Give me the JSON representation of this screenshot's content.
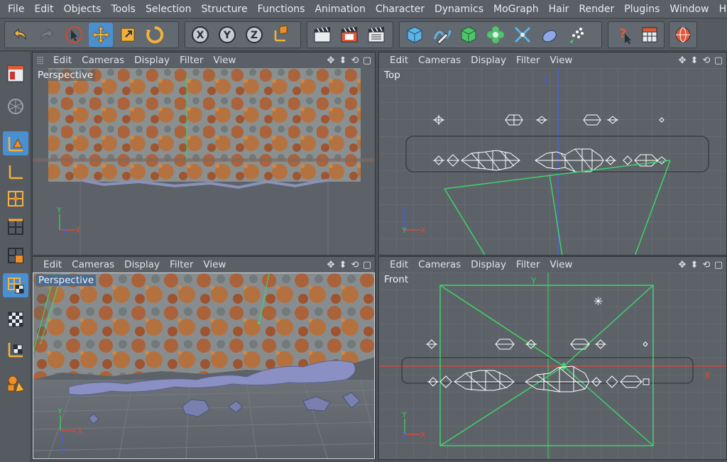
{
  "menubar": {
    "items": [
      "File",
      "Edit",
      "Objects",
      "Tools",
      "Selection",
      "Structure",
      "Functions",
      "Animation",
      "Character",
      "Dynamics",
      "MoGraph",
      "Hair",
      "Render",
      "Plugins",
      "Window",
      "Help"
    ]
  },
  "toolbar": {
    "axis_x": "X",
    "axis_y": "Y",
    "axis_z": "Z"
  },
  "viewport_menu": [
    "Edit",
    "Cameras",
    "Display",
    "Filter",
    "View"
  ],
  "viewport_nav": [
    "✥",
    "⬍",
    "⟲",
    "▢"
  ],
  "viewports": {
    "top_left": {
      "label": "Perspective"
    },
    "top_right": {
      "label": "Top"
    },
    "bottom_left": {
      "label": "Perspective"
    },
    "bottom_right": {
      "label": "Front"
    }
  },
  "axes": {
    "x": "X",
    "y": "Y",
    "z": "Z"
  },
  "colors": {
    "accent": "#4a8fd0",
    "grid": "#6b7177",
    "wire": "#ffffff",
    "camera": "#3fd36a",
    "x_axis": "#d94a3e",
    "y_axis": "#44c25a",
    "z_axis": "#4a5fd6"
  }
}
